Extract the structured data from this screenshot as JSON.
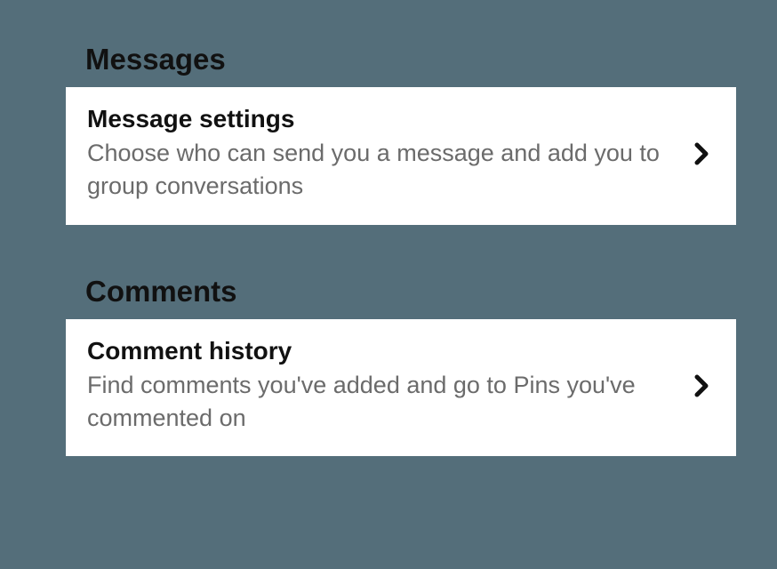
{
  "sections": [
    {
      "header": "Messages",
      "item": {
        "title": "Message settings",
        "description": "Choose who can send you a message and add you to group conversations"
      }
    },
    {
      "header": "Comments",
      "item": {
        "title": "Comment history",
        "description": "Find comments you've added and go to Pins you've commented on"
      }
    }
  ]
}
